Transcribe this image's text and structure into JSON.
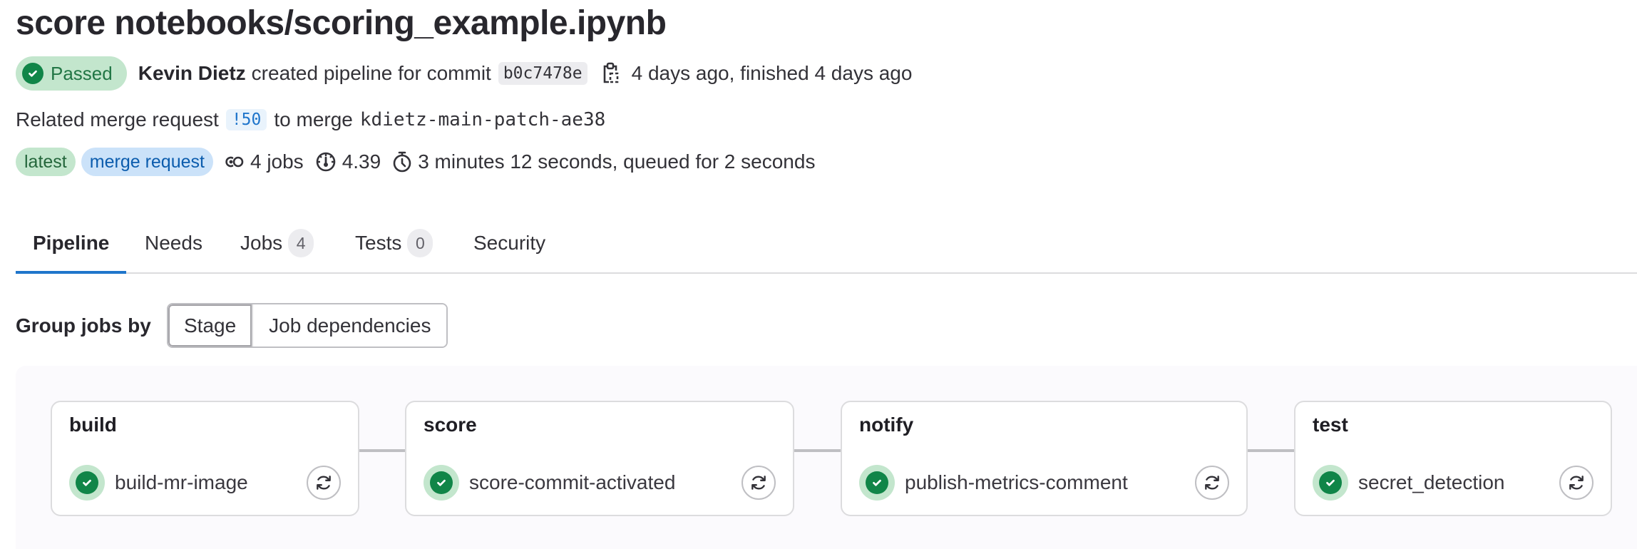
{
  "header": {
    "title": "score notebooks/scoring_example.ipynb",
    "status": {
      "label": "Passed",
      "icon": "status-success-icon",
      "color": "#108548"
    },
    "author": "Kevin Dietz",
    "created_text": "created pipeline for commit",
    "commit_sha": "b0c7478e",
    "copy_icon": "clipboard-copy-icon",
    "time_text": "4 days ago, finished 4 days ago",
    "related_prefix": "Related merge request",
    "merge_request_ref": "!50",
    "merge_text": "to merge",
    "source_branch": "kdietz-main-patch-ae38",
    "badges": [
      {
        "label": "latest",
        "color": "#c3e6cd"
      },
      {
        "label": "merge request",
        "color": "#cbe2f9"
      }
    ],
    "jobs_count": "4 jobs",
    "compute_minutes": "4.39",
    "duration": "3 minutes 12 seconds, queued for 2 seconds"
  },
  "tabs": [
    {
      "label": "Pipeline",
      "active": true
    },
    {
      "label": "Needs"
    },
    {
      "label": "Jobs",
      "count": "4"
    },
    {
      "label": "Tests",
      "count": "0"
    },
    {
      "label": "Security"
    }
  ],
  "group_by": {
    "label": "Group jobs by",
    "options": [
      {
        "label": "Stage",
        "selected": true
      },
      {
        "label": "Job dependencies"
      }
    ]
  },
  "stages": [
    {
      "title": "build",
      "jobs": [
        {
          "name": "build-mr-image",
          "status": "success",
          "action": "retry"
        }
      ]
    },
    {
      "title": "score",
      "jobs": [
        {
          "name": "score-commit-activated",
          "status": "success",
          "action": "retry"
        }
      ]
    },
    {
      "title": "notify",
      "jobs": [
        {
          "name": "publish-metrics-comment",
          "status": "success",
          "action": "retry"
        }
      ]
    },
    {
      "title": "test",
      "jobs": [
        {
          "name": "secret_detection",
          "status": "success",
          "action": "retry"
        }
      ]
    }
  ],
  "colors": {
    "accent": "#1f75cb",
    "success": "#108548",
    "success_bg": "#c3e6cd"
  }
}
